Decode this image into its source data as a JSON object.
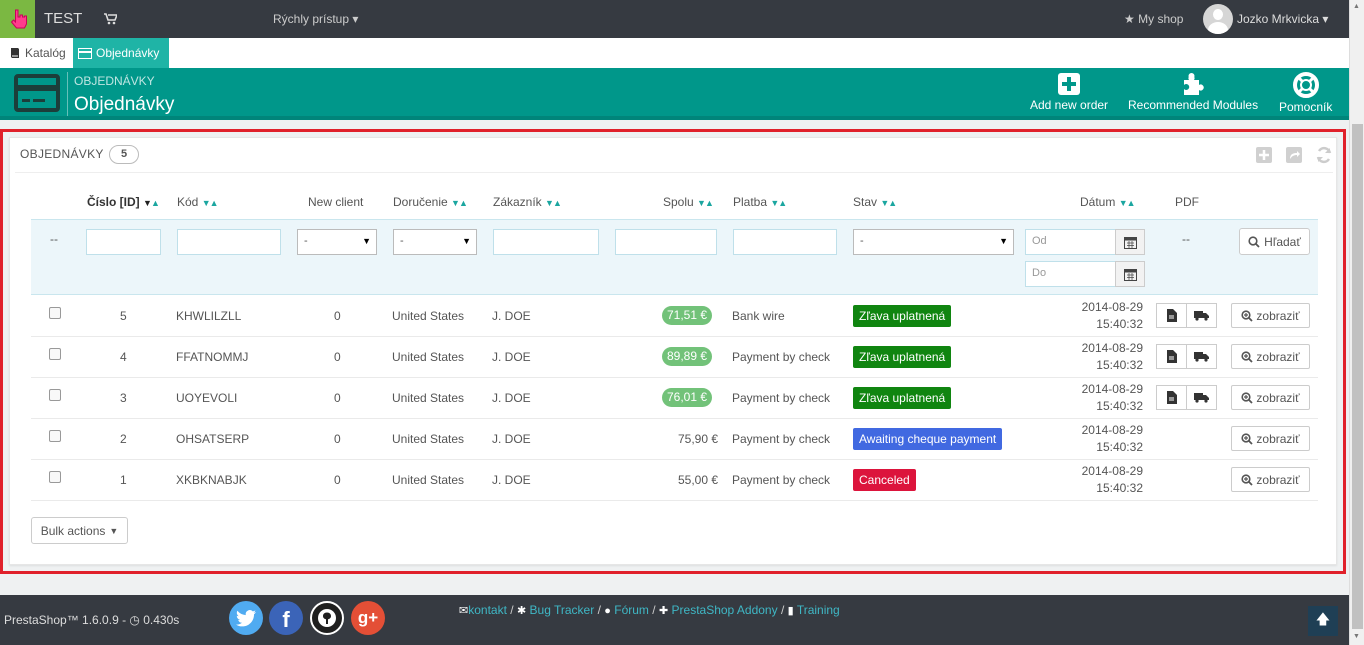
{
  "topbar": {
    "shop_name": "TEST",
    "quick_access": "Rýchly prístup",
    "my_shop": "My shop",
    "user_name": "Jozko Mrkvicka"
  },
  "tabs": [
    {
      "label": "Katalóg"
    },
    {
      "label": "Objednávky"
    }
  ],
  "page_header": {
    "breadcrumb": "OBJEDNÁVKY",
    "title": "Objednávky",
    "actions": [
      {
        "label": "Add new order",
        "icon": "plus-square-icon"
      },
      {
        "label": "Recommended Modules",
        "icon": "puzzle-icon"
      },
      {
        "label": "Pomocník",
        "icon": "lifebuoy-icon"
      }
    ]
  },
  "panel": {
    "title": "OBJEDNÁVKY",
    "count": "5"
  },
  "columns": {
    "id": "Číslo [ID]",
    "code": "Kód",
    "new_client": "New client",
    "delivery": "Doručenie",
    "customer": "Zákazník",
    "total": "Spolu",
    "payment": "Platba",
    "status": "Stav",
    "date": "Dátum",
    "pdf": "PDF"
  },
  "filters": {
    "id_dash": "--",
    "select_placeholder": "-",
    "date_from": "Od",
    "date_to": "Do",
    "pdf_dash": "--",
    "search_label": "Hľadať"
  },
  "orders": [
    {
      "id": "5",
      "code": "KHWLILZLL",
      "new_client": "0",
      "delivery": "United States",
      "customer": "J. DOE",
      "total": "71,51 €",
      "payment": "Bank wire",
      "status": "Zľava uplatnená",
      "status_color": "#108510",
      "date": "2014-08-29",
      "time": "15:40:32",
      "view": "zobraziť"
    },
    {
      "id": "4",
      "code": "FFATNOMMJ",
      "new_client": "0",
      "delivery": "United States",
      "customer": "J. DOE",
      "total": "89,89 €",
      "payment": "Payment by check",
      "status": "Zľava uplatnená",
      "status_color": "#108510",
      "date": "2014-08-29",
      "time": "15:40:32",
      "view": "zobraziť"
    },
    {
      "id": "3",
      "code": "UOYEVOLI",
      "new_client": "0",
      "delivery": "United States",
      "customer": "J. DOE",
      "total": "76,01 €",
      "payment": "Payment by check",
      "status": "Zľava uplatnená",
      "status_color": "#108510",
      "date": "2014-08-29",
      "time": "15:40:32",
      "view": "zobraziť"
    },
    {
      "id": "2",
      "code": "OHSATSERP",
      "new_client": "0",
      "delivery": "United States",
      "customer": "J. DOE",
      "total": "75,90 €",
      "payment": "Payment by check",
      "status": "Awaiting cheque payment",
      "status_color": "#4169e1",
      "date": "2014-08-29",
      "time": "15:40:32",
      "view": "zobraziť"
    },
    {
      "id": "1",
      "code": "XKBKNABJK",
      "new_client": "0",
      "delivery": "United States",
      "customer": "J. DOE",
      "total": "55,00 €",
      "payment": "Payment by check",
      "status": "Canceled",
      "status_color": "#dc143c",
      "date": "2014-08-29",
      "time": "15:40:32",
      "view": "zobraziť"
    }
  ],
  "bulk_actions": "Bulk actions",
  "footer": {
    "version": "PrestaShop™ 1.6.0.9 -",
    "load_time": "0.430s",
    "links": [
      {
        "label": "kontakt",
        "icon": "envelope-icon"
      },
      {
        "label": "Bug Tracker",
        "icon": "bug-icon"
      },
      {
        "label": "Fórum",
        "icon": "comments-icon"
      },
      {
        "label": "PrestaShop Addony",
        "icon": "puzzle-icon"
      },
      {
        "label": "Training",
        "icon": "book-icon"
      }
    ],
    "separator": "/"
  },
  "colors": {
    "accent": "#00978a",
    "topbar": "#363a41",
    "price_badge": "#72c279",
    "frame": "#e0212b"
  }
}
